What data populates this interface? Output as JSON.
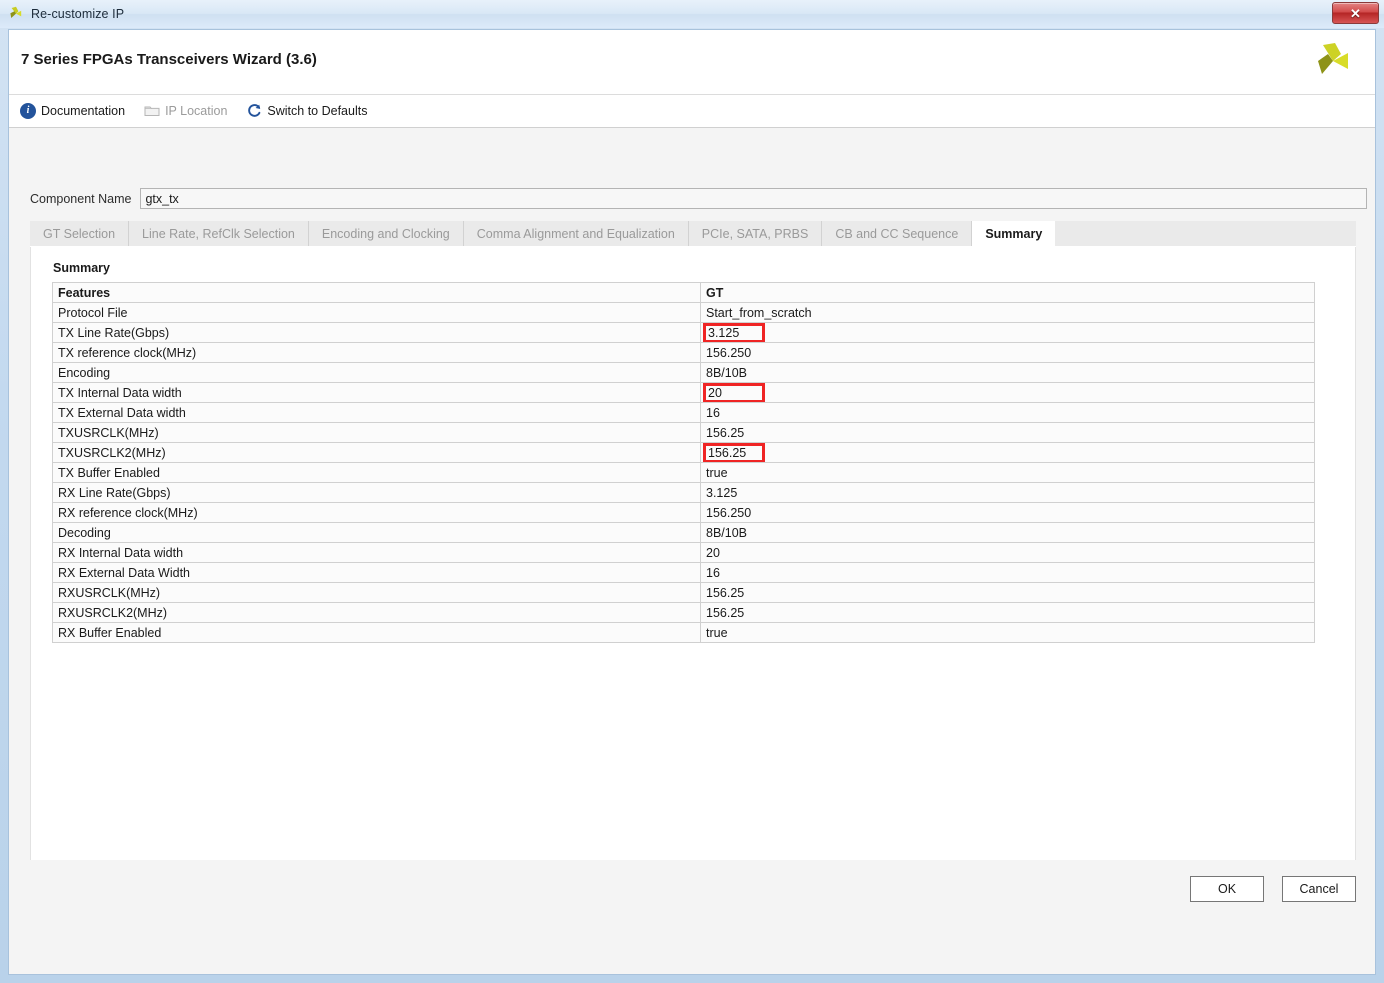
{
  "window": {
    "title": "Re-customize IP",
    "close_label": "✕",
    "app_icon": "xilinx-logo-icon"
  },
  "header": {
    "wizard_title": "7 Series FPGAs Transceivers Wizard (3.6)",
    "logo": "xilinx-logo-icon"
  },
  "toolbar": {
    "items": [
      {
        "label": "Documentation",
        "icon": "info-icon",
        "disabled": false
      },
      {
        "label": "IP Location",
        "icon": "folder-icon",
        "disabled": true
      },
      {
        "label": "Switch to Defaults",
        "icon": "refresh-icon",
        "disabled": false
      }
    ]
  },
  "component_name": {
    "label": "Component Name",
    "value": "gtx_tx",
    "placeholder": ""
  },
  "tabs": [
    {
      "label": "GT Selection",
      "active": false
    },
    {
      "label": "Line Rate, RefClk Selection",
      "active": false
    },
    {
      "label": "Encoding and Clocking",
      "active": false
    },
    {
      "label": "Comma Alignment and Equalization",
      "active": false
    },
    {
      "label": "PCIe, SATA, PRBS",
      "active": false
    },
    {
      "label": "CB and CC Sequence",
      "active": false
    },
    {
      "label": "Summary",
      "active": true
    }
  ],
  "content": {
    "heading": "Summary",
    "table": {
      "columns": [
        "Features",
        "GT"
      ],
      "rows": [
        {
          "feature": "Protocol File",
          "value": "Start_from_scratch",
          "highlight": false
        },
        {
          "feature": "TX Line Rate(Gbps)",
          "value": "3.125",
          "highlight": true
        },
        {
          "feature": "TX reference clock(MHz)",
          "value": "156.250",
          "highlight": false
        },
        {
          "feature": "Encoding",
          "value": "8B/10B",
          "highlight": false
        },
        {
          "feature": "TX Internal Data width",
          "value": "20",
          "highlight": true
        },
        {
          "feature": "TX External Data width",
          "value": "16",
          "highlight": false
        },
        {
          "feature": "TXUSRCLK(MHz)",
          "value": "156.25",
          "highlight": false
        },
        {
          "feature": "TXUSRCLK2(MHz)",
          "value": "156.25",
          "highlight": true
        },
        {
          "feature": "TX Buffer Enabled",
          "value": "true",
          "highlight": false
        },
        {
          "feature": "RX Line Rate(Gbps)",
          "value": "3.125",
          "highlight": false
        },
        {
          "feature": "RX reference clock(MHz)",
          "value": "156.250",
          "highlight": false
        },
        {
          "feature": "Decoding",
          "value": "8B/10B",
          "highlight": false
        },
        {
          "feature": "RX Internal Data width",
          "value": "20",
          "highlight": false
        },
        {
          "feature": "RX External Data Width",
          "value": "16",
          "highlight": false
        },
        {
          "feature": "RXUSRCLK(MHz)",
          "value": "156.25",
          "highlight": false
        },
        {
          "feature": "RXUSRCLK2(MHz)",
          "value": "156.25",
          "highlight": false
        },
        {
          "feature": "RX Buffer Enabled",
          "value": "true",
          "highlight": false
        }
      ]
    }
  },
  "footer": {
    "ok_label": "OK",
    "cancel_label": "Cancel"
  },
  "colors": {
    "highlight_red": "#ef2424",
    "accent_blue": "#23539b",
    "logo_yellow": "#d8dc28",
    "logo_olive": "#8e9318",
    "close_red": "#b52525"
  }
}
